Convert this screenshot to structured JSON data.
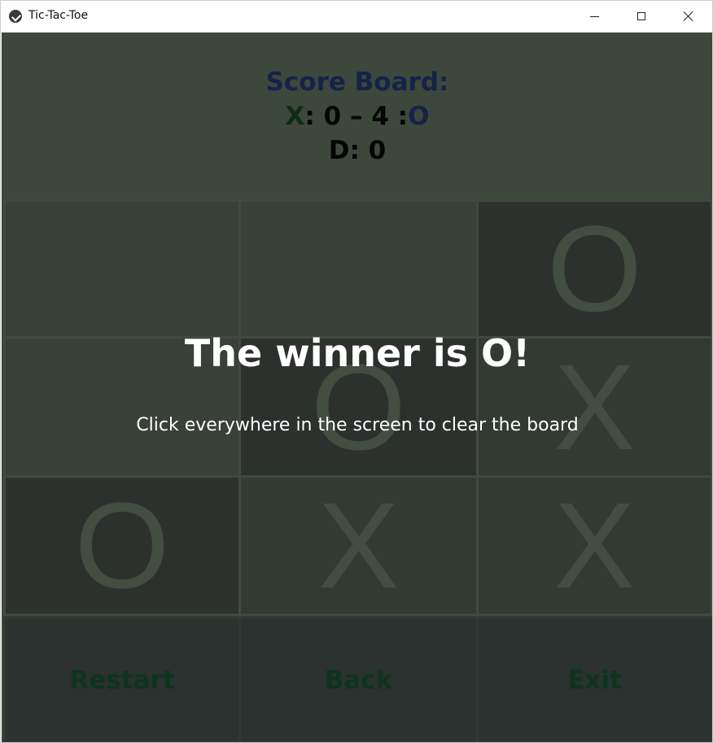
{
  "window": {
    "title": "Tic-Tac-Toe",
    "controls": [
      "minimize",
      "maximize",
      "close"
    ]
  },
  "scoreboard": {
    "title": "Score Board:",
    "x_label": "X",
    "x_score": "0",
    "separator": "–",
    "o_score": "4",
    "o_label": "O",
    "draw_label": "D",
    "draw_score": "0"
  },
  "board": {
    "cells": [
      "",
      "",
      "O",
      "",
      "O",
      "X",
      "O",
      "X",
      "X"
    ]
  },
  "overlay": {
    "title": "The winner is O!",
    "subtitle": "Click everywhere in the screen to clear the board"
  },
  "buttons": {
    "restart": "Restart",
    "back": "Back",
    "exit": "Exit"
  },
  "colors": {
    "background": "#3d473c",
    "x_accent": "#0f2a15",
    "o_accent": "#15224a",
    "button_text": "#0d3520"
  }
}
